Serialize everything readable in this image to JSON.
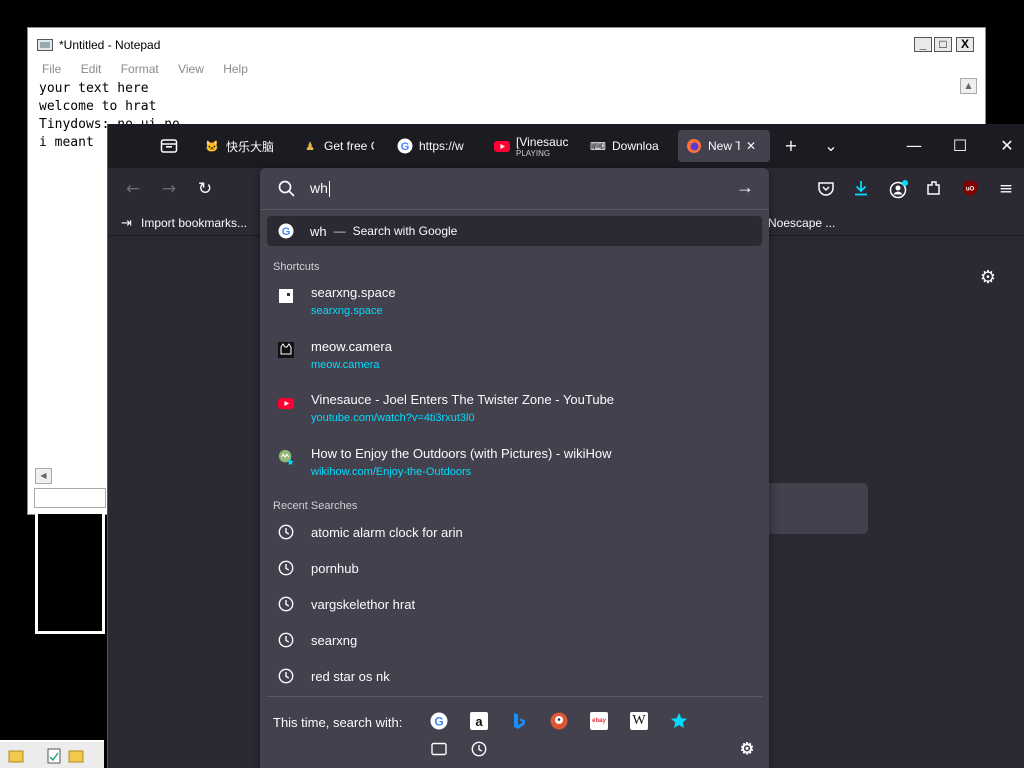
{
  "notepad": {
    "title": "*Untitled - Notepad",
    "menu": [
      "File",
      "Edit",
      "Format",
      "View",
      "Help"
    ],
    "lines": [
      "your text here",
      "welcome to hrat",
      "Tinydows: no ui no",
      "i meant"
    ],
    "controls": {
      "minimize": "_",
      "maximize": "□",
      "close": "X"
    }
  },
  "tabs": [
    {
      "label": "快乐大脑",
      "icon": "cat-face-icon"
    },
    {
      "label": "Get free C",
      "icon": "figure-icon"
    },
    {
      "label": "https://w",
      "icon": "google-icon"
    },
    {
      "label": "[Vinesauc",
      "sub": "PLAYING",
      "icon": "youtube-icon"
    },
    {
      "label": "Downloa",
      "icon": "keyboard-icon"
    },
    {
      "label": "New Ta",
      "icon": "firefox-icon",
      "active": true
    }
  ],
  "tabbar": {
    "new_tab": "+",
    "list_all": "⌄",
    "close_tab": "✕"
  },
  "window": {
    "minimize": "—",
    "maximize": "☐",
    "close": "✕"
  },
  "bookmarks": {
    "import": "Import bookmarks...",
    "right_item": "Noescape ..."
  },
  "urlbar": {
    "value": "wh",
    "go_arrow": "→",
    "google_row": {
      "query": "wh",
      "dash": "—",
      "text": "Search with Google"
    }
  },
  "shortcuts": {
    "heading": "Shortcuts",
    "items": [
      {
        "title": "searxng.space",
        "url": "searxng.space",
        "icon": "searxng-icon"
      },
      {
        "title": "meow.camera",
        "url": "meow.camera",
        "icon": "cat-camera-icon"
      },
      {
        "title": "Vinesauce - Joel Enters The Twister Zone - YouTube",
        "url": "youtube.com/watch?v=4ti3rxut3l0",
        "icon": "youtube-icon"
      },
      {
        "title": "How to Enjoy the Outdoors (with Pictures) - wikiHow",
        "url": "wikihow.com/Enjoy-the-Outdoors",
        "icon": "wikihow-icon"
      }
    ]
  },
  "recent": {
    "heading": "Recent Searches",
    "items": [
      "atomic alarm clock for arin",
      "pornhub",
      "vargskelethor hrat",
      "searxng",
      "red star os nk"
    ]
  },
  "oneoff": {
    "label": "This time, search with:",
    "engines": [
      "google-icon",
      "amazon-icon",
      "bing-icon",
      "duckduckgo-icon",
      "ebay-icon",
      "wikipedia-icon",
      "bookmarks-star-icon"
    ],
    "wiki_glyph": "W",
    "amazon_glyph": "a",
    "ebay_glyph": "ebay"
  },
  "colors": {
    "accent_url": "#00ddff",
    "panel_bg": "#42414d",
    "toolbar_bg": "#2b2a33",
    "tabbar_bg": "#1c1b22"
  }
}
